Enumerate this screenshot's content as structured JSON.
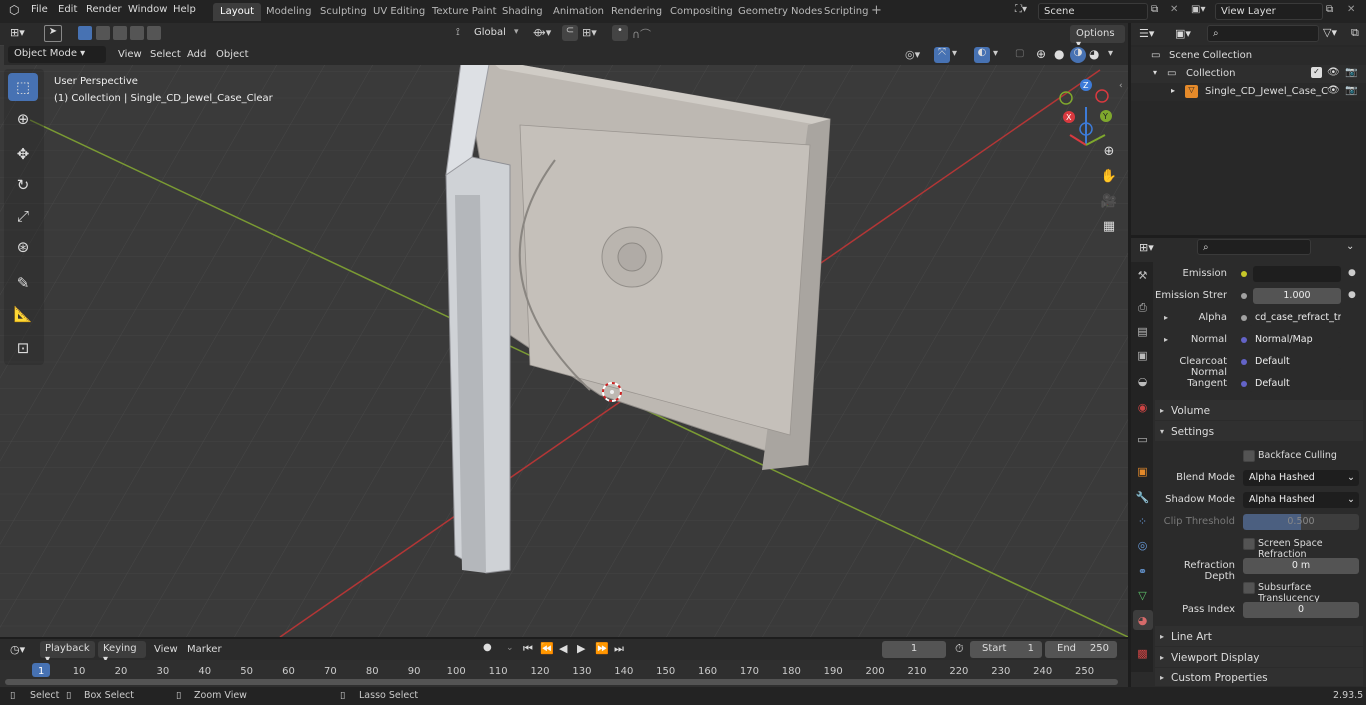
{
  "menu": {
    "file": "File",
    "edit": "Edit",
    "render": "Render",
    "window": "Window",
    "help": "Help"
  },
  "workspaces": [
    "Layout",
    "Modeling",
    "Sculpting",
    "UV Editing",
    "Texture Paint",
    "Shading",
    "Animation",
    "Rendering",
    "Compositing",
    "Geometry Nodes",
    "Scripting"
  ],
  "scene": {
    "name": "Scene",
    "view_layer": "View Layer"
  },
  "viewport": {
    "transform": "Global",
    "options": "Options",
    "mode": "Object Mode",
    "menu": [
      "View",
      "Select",
      "Add",
      "Object"
    ],
    "overlay_title": "User Perspective",
    "overlay_sub": "(1) Collection | Single_CD_Jewel_Case_Clear",
    "gizmo": {
      "x": "X",
      "y": "Y",
      "z": "Z"
    }
  },
  "outliner": {
    "root": "Scene Collection",
    "collection": "Collection",
    "object": "Single_CD_Jewel_Case_C"
  },
  "props": {
    "rows": [
      {
        "label": "Emission",
        "value": "",
        "kind": "color"
      },
      {
        "label": "Emission Strengt",
        "value": "1.000",
        "kind": "num"
      },
      {
        "label": "Alpha",
        "value": "cd_case_refract_tran...",
        "kind": "link"
      },
      {
        "label": "Normal",
        "value": "Normal/Map",
        "kind": "link"
      },
      {
        "label": "Clearcoat Normal",
        "value": "Default",
        "kind": "link"
      },
      {
        "label": "Tangent",
        "value": "Default",
        "kind": "link"
      }
    ],
    "volume": "Volume",
    "settings": "Settings",
    "backface": "Backface Culling",
    "blend_label": "Blend Mode",
    "blend": "Alpha Hashed",
    "shadow_label": "Shadow Mode",
    "shadow": "Alpha Hashed",
    "clip_label": "Clip Threshold",
    "clip": "0.500",
    "ssr": "Screen Space Refraction",
    "refr_label": "Refraction Depth",
    "refr": "0 m",
    "sss": "Subsurface Translucency",
    "pass_label": "Pass Index",
    "pass": "0",
    "line_art": "Line Art",
    "viewport_display": "Viewport Display",
    "custom_props": "Custom Properties"
  },
  "timeline": {
    "playback": "Playback",
    "keying": "Keying",
    "view": "View",
    "marker": "Marker",
    "frame": "1",
    "start_label": "Start",
    "start": "1",
    "end_label": "End",
    "end": "250",
    "ticks": [
      "1",
      "10",
      "20",
      "30",
      "40",
      "50",
      "60",
      "70",
      "80",
      "90",
      "100",
      "110",
      "120",
      "130",
      "140",
      "150",
      "160",
      "170",
      "180",
      "190",
      "200",
      "210",
      "220",
      "230",
      "240",
      "250"
    ]
  },
  "status": {
    "select": "Select",
    "box_select": "Box Select",
    "zoom": "Zoom View",
    "lasso": "Lasso Select",
    "version": "2.93.5"
  },
  "colors": {
    "accent": "#4772b3",
    "x_axis": "#d9393f",
    "y_axis": "#7fa82d",
    "z_axis": "#3d7bd8",
    "socket_yellow": "#c7c729",
    "socket_purple": "#6363c7",
    "socket_gray": "#a1a1a1"
  }
}
